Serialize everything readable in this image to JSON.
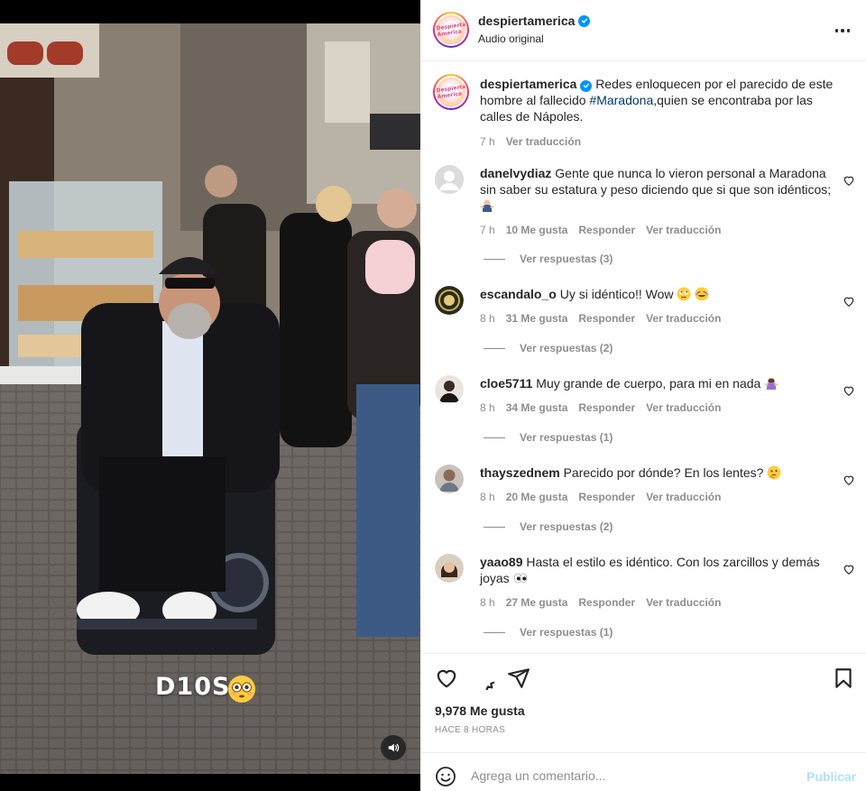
{
  "post": {
    "username": "despiertamerica",
    "audio": "Audio original",
    "avatar_text": "Despierta America",
    "caption_text": "Redes enloquecen por el parecido de este hombre al fallecido ",
    "caption_hashtag": "#Maradona",
    "caption_tail": ",quien se encontraba por las calles de Nápoles.",
    "caption_time": "7 h",
    "translate_label": "Ver traducción"
  },
  "media": {
    "overlay_text": "D10S",
    "overlay_emoji": "flushed-face-emoji",
    "audio_icon": "speaker-icon"
  },
  "comments": [
    {
      "username": "danelvydiaz",
      "text": "Gente que nunca lo vieron personal a Maradona sin saber su estatura y peso diciendo que si que son idénticos;",
      "emoji": "person-shrugging-emoji",
      "time": "7 h",
      "likes": "10 Me gusta",
      "reply": "Responder",
      "translate": "Ver traducción",
      "replies": "Ver respuestas (3)"
    },
    {
      "username": "escandalo_o",
      "text": "Uy si idéntico!! Wow",
      "emoji": "rolling-eyes-and-laughing-emoji",
      "time": "8 h",
      "likes": "31 Me gusta",
      "reply": "Responder",
      "translate": "Ver traducción",
      "replies": "Ver respuestas (2)"
    },
    {
      "username": "cloe5711",
      "text": "Muy grande de cuerpo, para mi en nada",
      "emoji": "woman-shrugging-emoji",
      "time": "8 h",
      "likes": "34 Me gusta",
      "reply": "Responder",
      "translate": "Ver traducción",
      "replies": "Ver respuestas (1)"
    },
    {
      "username": "thayszednem",
      "text": "Parecido por dónde? En los lentes?",
      "emoji": "thinking-face-emoji",
      "time": "8 h",
      "likes": "20 Me gusta",
      "reply": "Responder",
      "translate": "Ver traducción",
      "replies": "Ver respuestas (2)"
    },
    {
      "username": "yaao89",
      "text": "Hasta el estilo es idéntico. Con los zarcillos y demás joyas",
      "emoji": "eyes-emoji",
      "time": "8 h",
      "likes": "27 Me gusta",
      "reply": "Responder",
      "translate": "Ver traducción",
      "replies": "Ver respuestas (1)"
    }
  ],
  "actions": {
    "likes": "9,978 Me gusta",
    "posted": "HACE 8 HORAS",
    "comment_placeholder": "Agrega un comentario...",
    "publish": "Publicar"
  },
  "colors": {
    "link": "#00376b",
    "muted": "#8e8e8e",
    "verified": "#0095f6",
    "publish_disabled": "#b2dffc"
  }
}
